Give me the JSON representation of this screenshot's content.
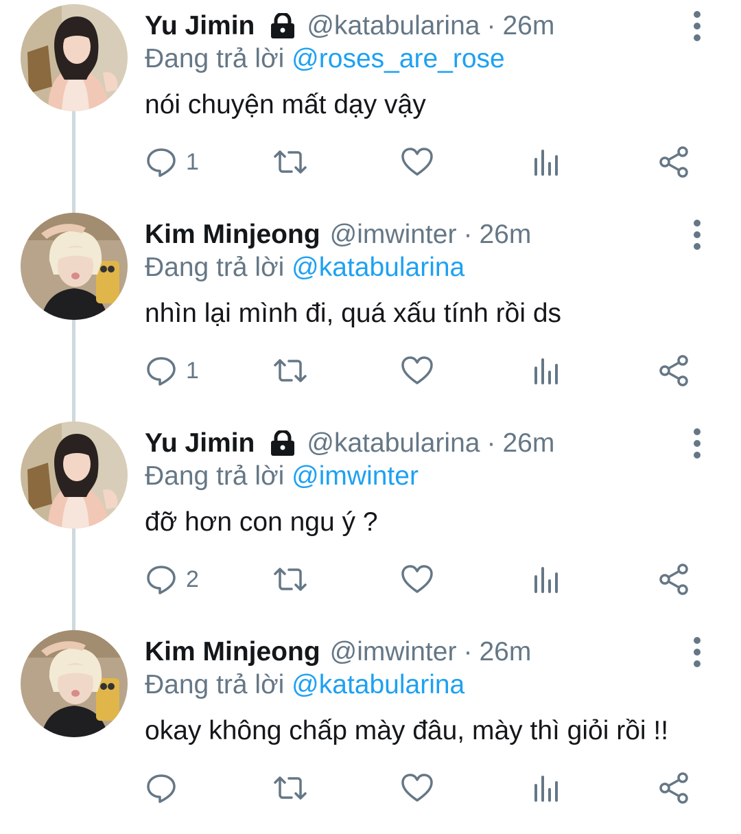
{
  "tweets": [
    {
      "name": "Yu Jimin",
      "locked": true,
      "handle": "@katabularina",
      "time": "26m",
      "reply_prefix": "Đang trả lời",
      "reply_to": "@roses_are_rose",
      "text": "nói chuyện mất dạy vậy",
      "reply_count": "1",
      "avatar": "yu-jimin-avatar"
    },
    {
      "name": "Kim Minjeong",
      "locked": false,
      "handle": "@imwinter",
      "time": "26m",
      "reply_prefix": "Đang trả lời",
      "reply_to": "@katabularina",
      "text": "nhìn lại mình đi, quá xấu tính rồi ds",
      "reply_count": "1",
      "avatar": "kim-minjeong-avatar"
    },
    {
      "name": "Yu Jimin",
      "locked": true,
      "handle": "@katabularina",
      "time": "26m",
      "reply_prefix": "Đang trả lời",
      "reply_to": "@imwinter",
      "text": "đỡ hơn con ngu ý ?",
      "reply_count": "2",
      "avatar": "yu-jimin-avatar"
    },
    {
      "name": "Kim Minjeong",
      "locked": false,
      "handle": "@imwinter",
      "time": "26m",
      "reply_prefix": "Đang trả lời",
      "reply_to": "@katabularina",
      "text": "okay không chấp mày đâu, mày thì giỏi rồi !!",
      "reply_count": "",
      "avatar": "kim-minjeong-avatar"
    }
  ],
  "separator": "·",
  "icons": {
    "reply": "reply-icon",
    "retweet": "retweet-icon",
    "like": "heart-icon",
    "analytics": "analytics-icon",
    "share": "share-icon",
    "more": "more-vertical-icon",
    "lock": "lock-icon"
  },
  "colors": {
    "mention": "#1da1f2",
    "muted": "#657786",
    "text": "#14171a",
    "thread_line": "#cfd9de"
  }
}
